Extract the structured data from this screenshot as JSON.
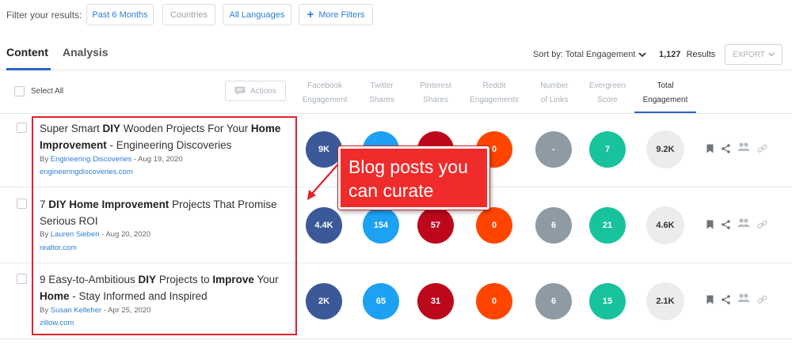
{
  "filters": {
    "label": "Filter your results:",
    "buttons": [
      "Past 6 Months",
      "Countries",
      "All Languages",
      "More Filters"
    ]
  },
  "tabs": [
    "Content",
    "Analysis"
  ],
  "sort": {
    "label": "Sort by: Total Engagement",
    "count": "1,127",
    "results_label": "Results",
    "export": "EXPORT"
  },
  "header": {
    "select_all": "Select All",
    "actions": "Actions",
    "columns": [
      [
        "Facebook",
        "Engagement"
      ],
      [
        "Twitter",
        "Shares"
      ],
      [
        "Pinterest",
        "Shares"
      ],
      [
        "Reddit",
        "Engagements"
      ],
      [
        "Number",
        "of Links"
      ],
      [
        "Evergreen",
        "Score"
      ],
      [
        "Total",
        "Engagement"
      ]
    ]
  },
  "rows": [
    {
      "title_parts": [
        [
          "Super Smart ",
          false
        ],
        [
          "DIY",
          true
        ],
        [
          " Wooden Projects For Your ",
          false
        ],
        [
          "Home Improvement",
          true
        ],
        [
          " - Engineering Discoveries",
          false
        ]
      ],
      "by": "By",
      "author": "Engineering Discoveries",
      "date": " - Aug 19, 2020",
      "domain": "engineeringdiscoveries.com",
      "metrics": [
        "9K",
        "",
        "",
        "0",
        "-",
        "7"
      ],
      "total": "9.2K"
    },
    {
      "title_parts": [
        [
          "7 ",
          false
        ],
        [
          "DIY Home Improvement",
          true
        ],
        [
          " Projects That Promise Serious ROI",
          false
        ]
      ],
      "by": "By",
      "author": "Lauren Sieben",
      "date": " - Aug 20, 2020",
      "domain": "realtor.com",
      "metrics": [
        "4.4K",
        "154",
        "57",
        "0",
        "6",
        "21"
      ],
      "total": "4.6K"
    },
    {
      "title_parts": [
        [
          "9 Easy-to-Ambitious ",
          false
        ],
        [
          "DIY",
          true
        ],
        [
          " Projects to ",
          false
        ],
        [
          "Improve",
          true
        ],
        [
          " Your ",
          false
        ],
        [
          "Home",
          true
        ],
        [
          " - Stay Informed and Inspired",
          false
        ]
      ],
      "by": "By",
      "author": "Susan Kelleher",
      "date": " - Apr 25, 2020",
      "domain": "zillow.com",
      "metrics": [
        "2K",
        "65",
        "31",
        "0",
        "6",
        "15"
      ],
      "total": "2.1K"
    }
  ],
  "metric_colors": [
    "#3b5998",
    "#1da1f2",
    "#bd081c",
    "#ff4500",
    "#8e9ba5",
    "#18c29c"
  ],
  "callout": {
    "line1": "Blog posts you",
    "line2": "can curate"
  },
  "accent": "#2a66c4",
  "annotation_color": "#e0232a"
}
